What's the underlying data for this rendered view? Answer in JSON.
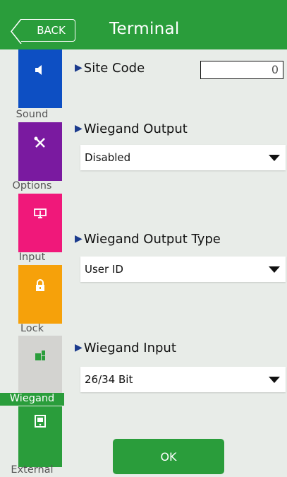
{
  "header": {
    "back_label": "BACK",
    "title": "Terminal"
  },
  "sidebar": {
    "items": [
      {
        "label": "Sound",
        "color": "#0d4fc3",
        "icon": "speaker-icon"
      },
      {
        "label": "Options",
        "color": "#7a1aa0",
        "icon": "tools-icon"
      },
      {
        "label": "Input",
        "color": "#f0187a",
        "icon": "input-device-icon"
      },
      {
        "label": "Lock",
        "color": "#f6a10a",
        "icon": "lock-icon"
      },
      {
        "label": "Wiegand",
        "color": "#d3d3d0",
        "icon": "wiegand-icon",
        "active": true
      },
      {
        "label": "External",
        "color": "#2a9d3b",
        "icon": "external-reader-icon"
      }
    ]
  },
  "form": {
    "site_code": {
      "label": "Site Code",
      "value": "0"
    },
    "wiegand_output": {
      "label": "Wiegand Output",
      "value": "Disabled"
    },
    "wiegand_output_type": {
      "label": "Wiegand Output Type",
      "value": "User ID"
    },
    "wiegand_input": {
      "label": "Wiegand Input",
      "value": "26/34 Bit"
    }
  },
  "ok_label": "OK",
  "colors": {
    "accent": "#2a9d3b",
    "triangle": "#1a3a8c",
    "background": "#e8ece8"
  }
}
